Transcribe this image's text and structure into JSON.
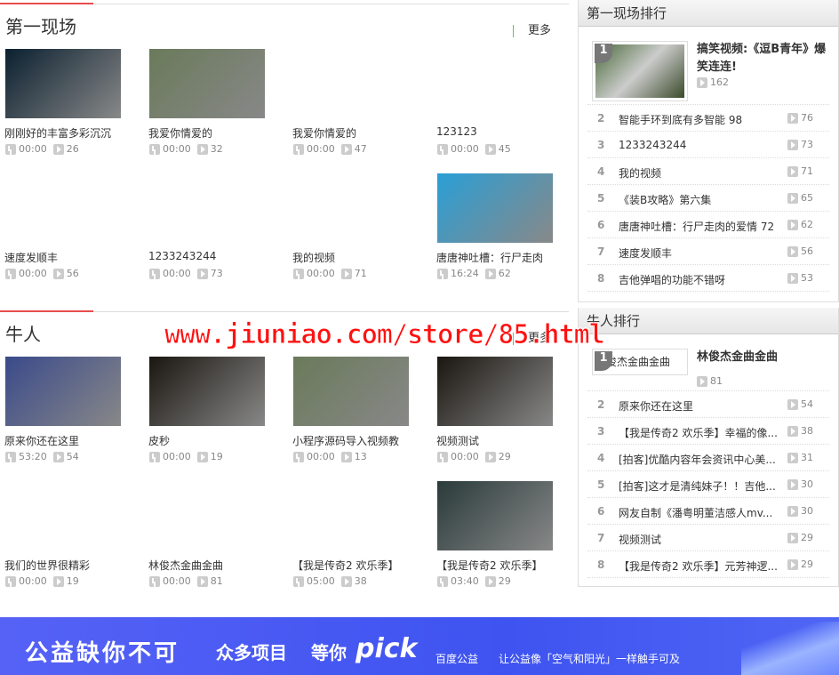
{
  "sections": [
    {
      "title": "第一现场",
      "more": "更多",
      "items": [
        {
          "title": "刚刚好的丰富多彩沉沉",
          "duration": "00:00",
          "views": "26",
          "thumb": "#0b2030"
        },
        {
          "title": "我爱你情爱的",
          "duration": "00:00",
          "views": "32",
          "thumb": "#6a7a5a"
        },
        {
          "title": "我爱你情爱的",
          "duration": "00:00",
          "views": "47",
          "thumb": ""
        },
        {
          "title": "123123",
          "duration": "00:00",
          "views": "45",
          "thumb": ""
        },
        {
          "title": "速度发顺丰",
          "duration": "00:00",
          "views": "56",
          "thumb": ""
        },
        {
          "title": "1233243244",
          "duration": "00:00",
          "views": "73",
          "thumb": ""
        },
        {
          "title": "我的视频",
          "duration": "00:00",
          "views": "71",
          "thumb": ""
        },
        {
          "title": "唐唐神吐槽：行尸走肉",
          "duration": "16:24",
          "views": "62",
          "thumb": "#2a9fd6"
        }
      ]
    },
    {
      "title": "牛人",
      "more": "更多",
      "items": [
        {
          "title": "原来你还在这里",
          "duration": "53:20",
          "views": "54",
          "thumb": "#3a4a8a"
        },
        {
          "title": "皮秒",
          "duration": "00:00",
          "views": "19",
          "thumb": "#1a1610"
        },
        {
          "title": "小程序源码导入视频教",
          "duration": "00:00",
          "views": "13",
          "thumb": "#6a7a5a"
        },
        {
          "title": "视频测试",
          "duration": "00:00",
          "views": "29",
          "thumb": "#1a1610"
        },
        {
          "title": "我们的世界很精彩",
          "duration": "00:00",
          "views": "19",
          "thumb": ""
        },
        {
          "title": "林俊杰金曲金曲",
          "duration": "00:00",
          "views": "81",
          "thumb": ""
        },
        {
          "title": "【我是传奇2 欢乐季】",
          "duration": "05:00",
          "views": "38",
          "thumb": ""
        },
        {
          "title": "【我是传奇2 欢乐季】",
          "duration": "03:40",
          "views": "29",
          "thumb": "#2a3a3a"
        }
      ]
    }
  ],
  "rankings": [
    {
      "title": "第一现场排行",
      "top": {
        "rank": "1",
        "title": "搞笑视频:《逗B青年》爆笑连连!",
        "views": "162",
        "alt": ""
      },
      "rows": [
        {
          "rank": "2",
          "title": "智能手环到底有多智能 98",
          "views": "76"
        },
        {
          "rank": "3",
          "title": "1233243244",
          "views": "73"
        },
        {
          "rank": "4",
          "title": "我的视频",
          "views": "71"
        },
        {
          "rank": "5",
          "title": "《装B攻略》第六集",
          "views": "65"
        },
        {
          "rank": "6",
          "title": "唐唐神吐槽：行尸走肉的爱情 72",
          "views": "62"
        },
        {
          "rank": "7",
          "title": "速度发顺丰",
          "views": "56"
        },
        {
          "rank": "8",
          "title": "吉他弹唱的功能不错呀",
          "views": "53"
        }
      ]
    },
    {
      "title": "牛人排行",
      "top": {
        "rank": "1",
        "title": "林俊杰金曲金曲",
        "views": "81",
        "alt": "林俊杰金曲金曲"
      },
      "rows": [
        {
          "rank": "2",
          "title": "原来你还在这里",
          "views": "54"
        },
        {
          "rank": "3",
          "title": "【我是传奇2 欢乐季】幸福的像...",
          "views": "38"
        },
        {
          "rank": "4",
          "title": "[拍客]优酷内容年会资讯中心美...",
          "views": "31"
        },
        {
          "rank": "5",
          "title": "[拍客]这才是清纯妹子！！吉他...",
          "views": "30"
        },
        {
          "rank": "6",
          "title": "网友自制《潘粤明董洁感人mv...",
          "views": "30"
        },
        {
          "rank": "7",
          "title": "视频测试",
          "views": "29"
        },
        {
          "rank": "8",
          "title": "【我是传奇2 欢乐季】元芳神逻...",
          "views": "29"
        }
      ]
    }
  ],
  "watermark": "www.jiuniao.com/store/85.html",
  "banner": {
    "slogan": "公益缺你不可",
    "s2": "众多项目",
    "s3": "等你",
    "pick": "pick",
    "brand": "百度公益",
    "tagline": "让公益像「空气和阳光」一样触手可及"
  }
}
